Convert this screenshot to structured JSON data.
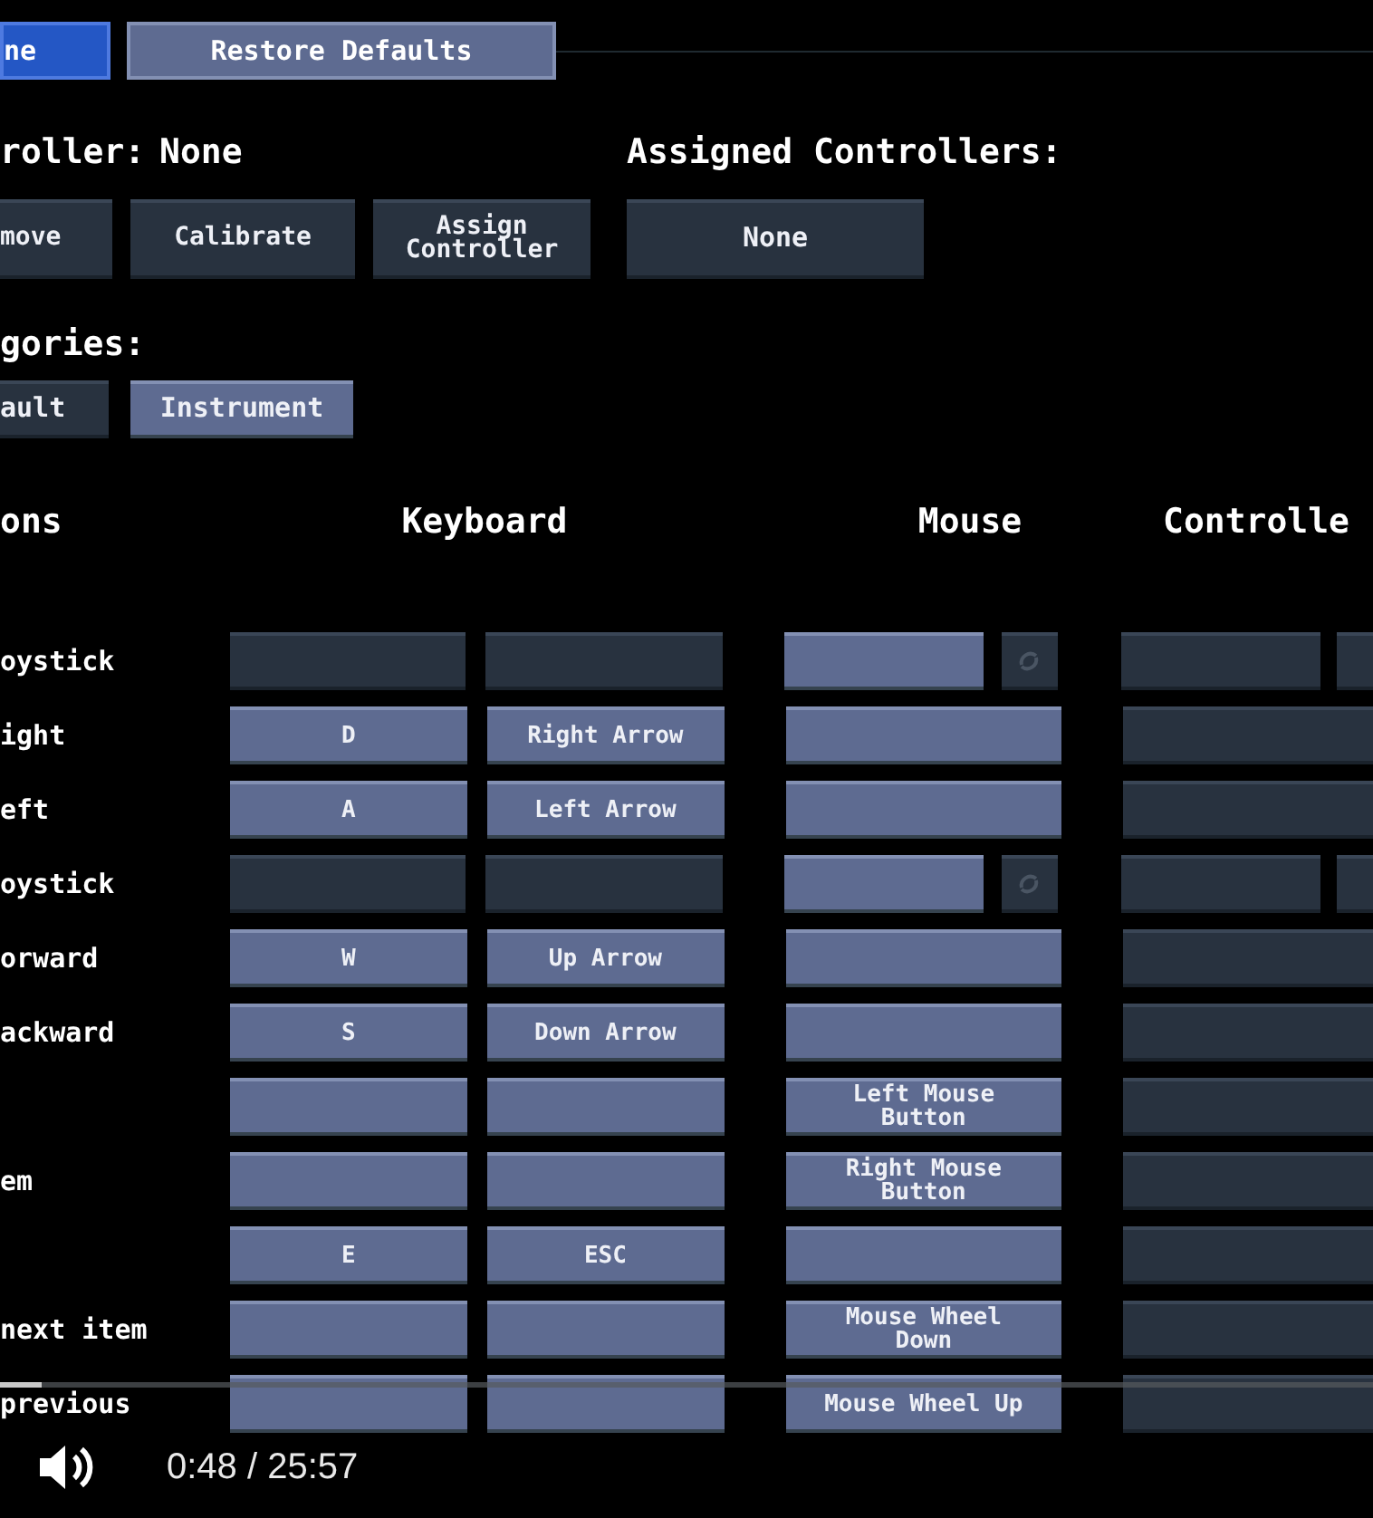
{
  "top_buttons": [
    {
      "label": "ne",
      "selected": true
    },
    {
      "label": "Restore Defaults",
      "selected": false
    }
  ],
  "controller": {
    "label": "roller:",
    "value": "None"
  },
  "assigned": {
    "label": "Assigned Controllers:"
  },
  "controller_buttons": [
    {
      "label": "move"
    },
    {
      "label": "Calibrate"
    },
    {
      "label": "Assign\nController"
    }
  ],
  "assigned_value": "None",
  "categories": {
    "label": "gories:",
    "tabs": [
      {
        "label": "ault",
        "selected": false
      },
      {
        "label": "Instrument",
        "selected": true
      }
    ]
  },
  "columns": [
    "ons",
    "Keyboard",
    "Mouse",
    "Controlle"
  ],
  "rows": [
    {
      "label": "oystick",
      "kind": "axis",
      "keyboard": [
        {
          "bound": false
        },
        {
          "bound": false
        }
      ],
      "mouse": {
        "bound": true
      }
    },
    {
      "label": "ight",
      "kind": "button",
      "keyboard": [
        {
          "text": "D",
          "bound": true
        },
        {
          "text": "Right Arrow",
          "bound": true
        }
      ],
      "mouse": {
        "bound": true
      }
    },
    {
      "label": "eft",
      "kind": "button",
      "keyboard": [
        {
          "text": "A",
          "bound": true
        },
        {
          "text": "Left Arrow",
          "bound": true
        }
      ],
      "mouse": {
        "bound": true
      }
    },
    {
      "label": "oystick",
      "kind": "axis",
      "keyboard": [
        {
          "bound": false
        },
        {
          "bound": false
        }
      ],
      "mouse": {
        "bound": true
      }
    },
    {
      "label": "orward",
      "kind": "button",
      "keyboard": [
        {
          "text": "W",
          "bound": true
        },
        {
          "text": "Up Arrow",
          "bound": true
        }
      ],
      "mouse": {
        "bound": true
      }
    },
    {
      "label": "ackward",
      "kind": "button",
      "keyboard": [
        {
          "text": "S",
          "bound": true
        },
        {
          "text": "Down Arrow",
          "bound": true
        }
      ],
      "mouse": {
        "bound": true
      }
    },
    {
      "kind": "button",
      "keyboard": [
        {
          "bound": true
        },
        {
          "bound": true
        }
      ],
      "mouse": {
        "text": "Left Mouse\nButton",
        "bound": true
      }
    },
    {
      "label": "em",
      "kind": "button",
      "keyboard": [
        {
          "bound": true
        },
        {
          "bound": true
        }
      ],
      "mouse": {
        "text": "Right Mouse\nButton",
        "bound": true
      }
    },
    {
      "kind": "button",
      "keyboard": [
        {
          "text": "E",
          "bound": true
        },
        {
          "text": "ESC",
          "bound": true
        }
      ],
      "mouse": {
        "bound": true
      }
    },
    {
      "label": "next item",
      "kind": "button",
      "keyboard": [
        {
          "bound": true
        },
        {
          "bound": true
        }
      ],
      "mouse": {
        "text": "Mouse Wheel\nDown",
        "bound": true
      }
    },
    {
      "label": "previous",
      "kind": "button",
      "keyboard": [
        {
          "bound": true
        },
        {
          "bound": true
        }
      ],
      "mouse": {
        "text": "Mouse Wheel Up",
        "bound": true
      }
    }
  ],
  "video_player": {
    "time": "0:48 / 25:57",
    "level": 0.03
  }
}
